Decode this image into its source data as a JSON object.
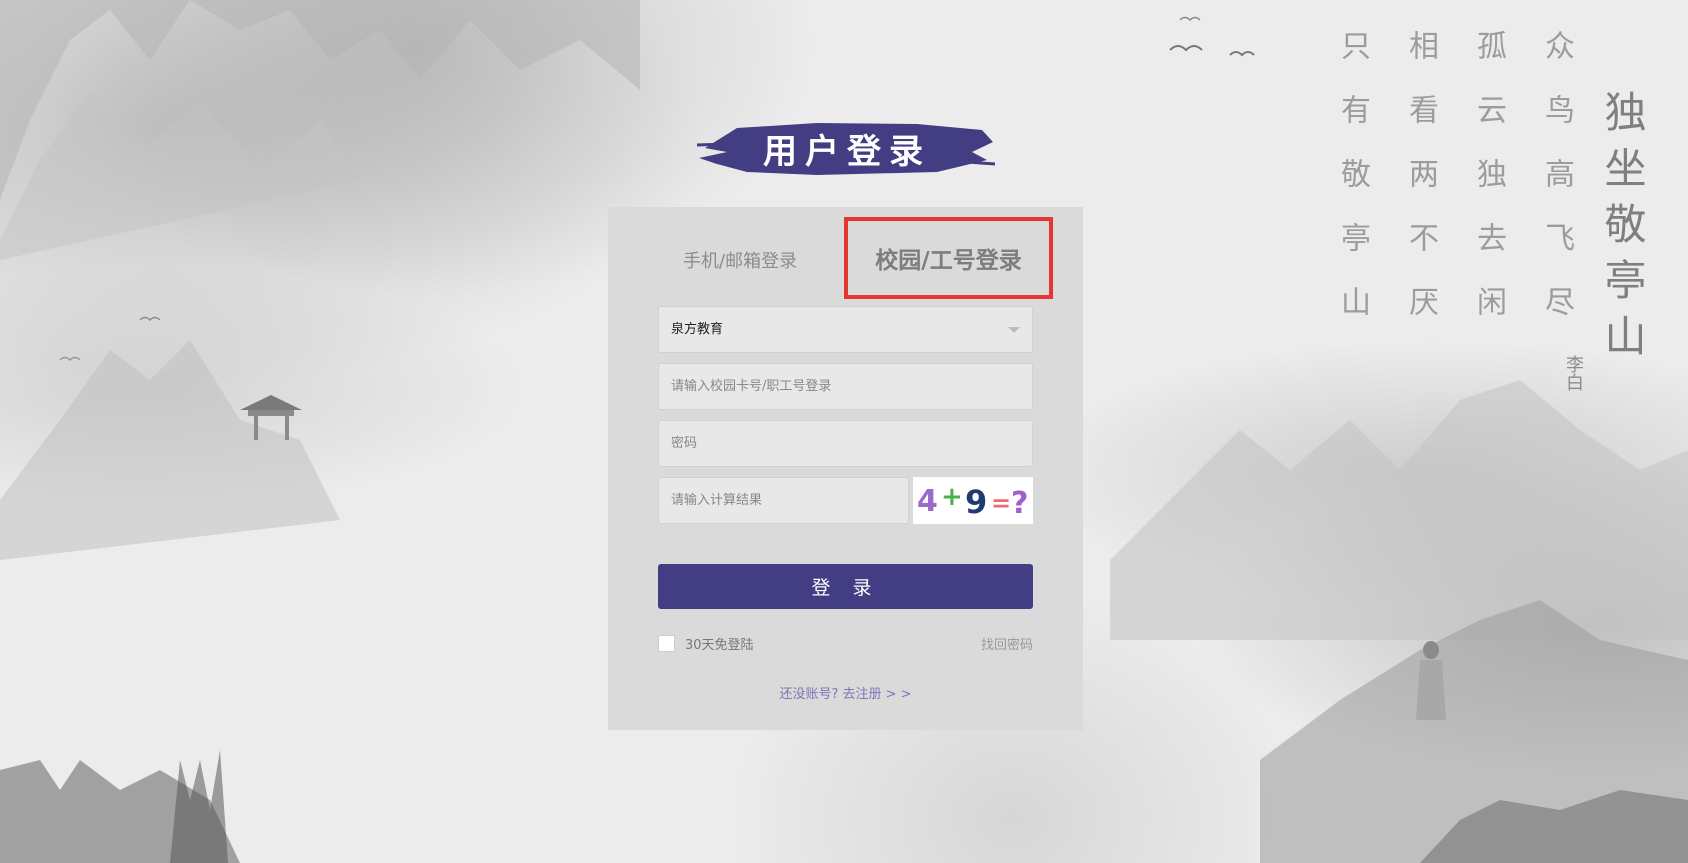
{
  "page": {
    "title": "用户登录"
  },
  "poem": {
    "columns": [
      "众鸟高飞尽",
      "孤云独去闲",
      "相看两不厌",
      "只有敬亭山"
    ],
    "title": "独坐敬亭山",
    "author": "李白"
  },
  "tabs": {
    "phone": "手机/邮箱登录",
    "campus": "校园/工号登录",
    "active": "campus"
  },
  "form": {
    "school": {
      "value": "泉方教育"
    },
    "card": {
      "placeholder": "请输入校园卡号/职工号登录"
    },
    "password": {
      "placeholder": "密码"
    },
    "captcha": {
      "placeholder": "请输入计算结果",
      "image_text": "4+9=?"
    },
    "login_button": "登 录",
    "remember": "30天免登陆",
    "forgot": "找回密码",
    "register": "还没账号? 去注册 > >"
  },
  "colors": {
    "accent": "#433d83",
    "highlight_border": "#e53636",
    "panel": "#dadada"
  }
}
